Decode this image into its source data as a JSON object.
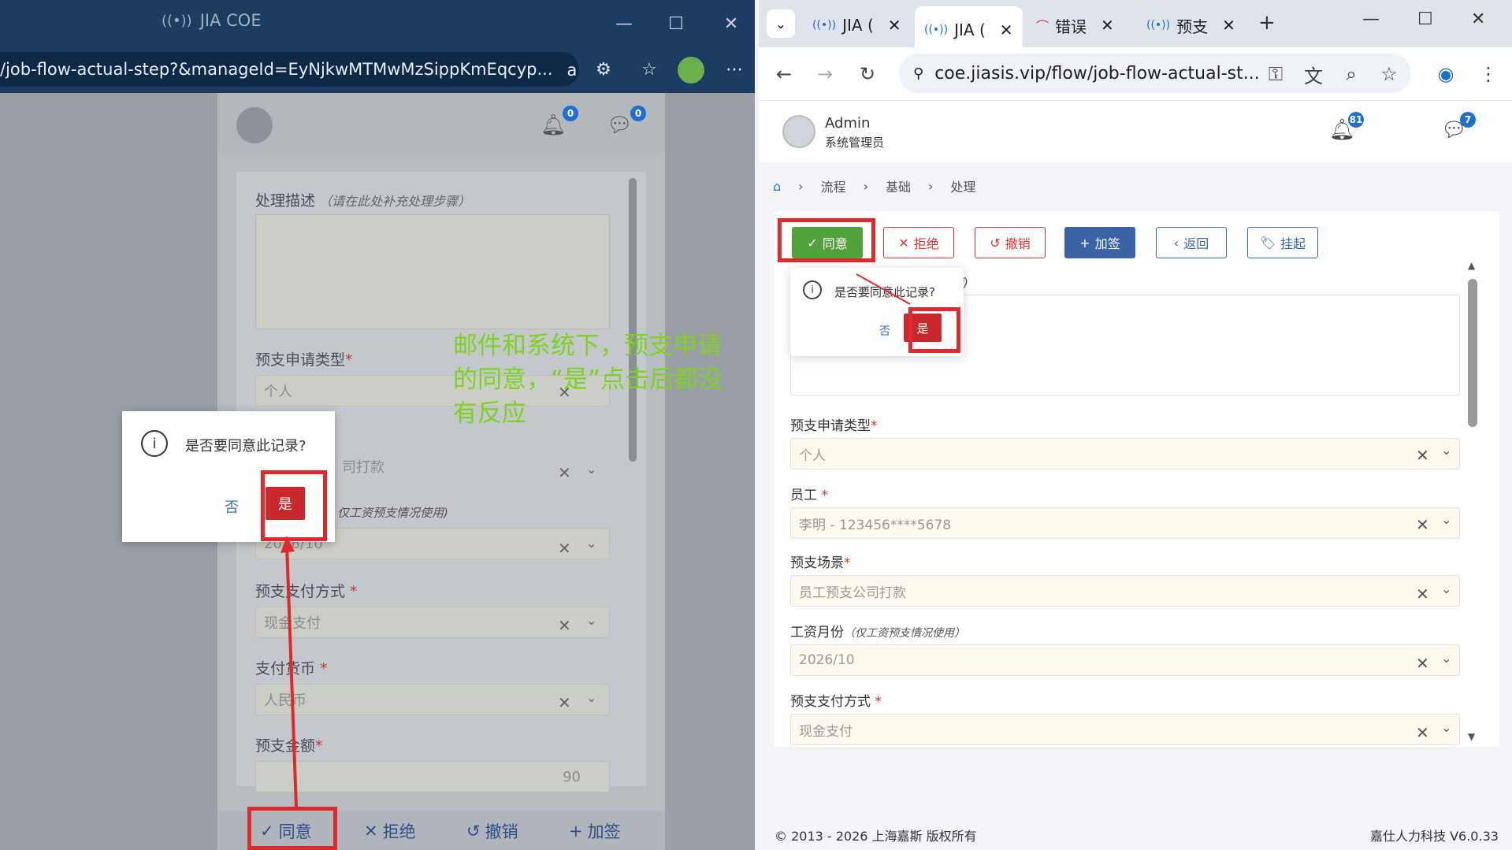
{
  "left_window": {
    "title": "JIA COE",
    "address": "/job-flow-actual-step?&manageId=EyNjkwMTMwMzSippKmEqcyp...",
    "notif_count_1": "0",
    "notif_count_2": "0",
    "form": {
      "desc_label": "处理描述",
      "desc_hint": "（请在此处补充处理步骤）",
      "type_label": "预支申请类型",
      "type_value": "个人",
      "scene_value": "司打款",
      "month_hint": "仅工资预支情况使用)",
      "month_value": "2026/10",
      "pay_label": "预支支付方式",
      "pay_value": "现金支付",
      "currency_label": "支付货币",
      "currency_value": "人民币",
      "amount_label": "预支金额",
      "amount_value": "90"
    },
    "dialog": {
      "message": "是否要同意此记录?",
      "no": "否",
      "yes": "是"
    },
    "bottom": {
      "agree": "同意",
      "reject": "拒绝",
      "undo": "撤销",
      "sign": "加签"
    }
  },
  "annotation": "邮件和系统下，预支申请的同意，“是”点击后都没有反应",
  "right_window": {
    "tabs": [
      {
        "label": "JIA ("
      },
      {
        "label": "JIA ("
      },
      {
        "label": "错误"
      },
      {
        "label": "预支"
      }
    ],
    "url": "coe.jiasis.vip/flow/job-flow-actual-st...",
    "user": {
      "name": "Admin",
      "role": "系统管理员"
    },
    "bell_count": "81",
    "msg_count": "7",
    "breadcrumb": [
      "流程",
      "基础",
      "处理"
    ],
    "actions": {
      "agree": "同意",
      "reject": "拒绝",
      "undo": "撤销",
      "sign": "加签",
      "back": "返回",
      "hang": "挂起"
    },
    "popconfirm": {
      "message": "是否要同意此记录?",
      "no": "否",
      "yes": "是"
    },
    "desc_hint_tail": "骤)",
    "form": {
      "type_label": "预支申请类型",
      "type_value": "个人",
      "emp_label": "员工",
      "emp_value": "李明 - 123456****5678",
      "scene_label": "预支场景",
      "scene_value": "员工预支公司打款",
      "month_label": "工资月份",
      "month_hint": "（仅工资预支情况使用）",
      "month_value": "2026/10",
      "pay_label": "预支支付方式",
      "pay_value": "现金支付"
    },
    "footer_left": "© 2013 - 2026 上海嘉斯 版权所有",
    "footer_right": "嘉仕人力科技 V6.0.33"
  }
}
